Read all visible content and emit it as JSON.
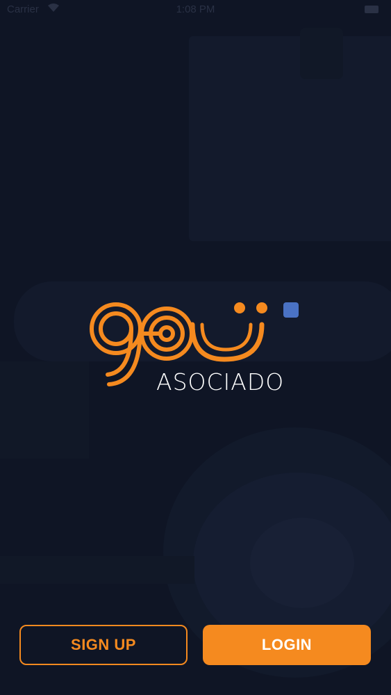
{
  "status_bar": {
    "carrier": "Carrier",
    "time": "1:08 PM"
  },
  "logo": {
    "subtitle": "ASOCIADO",
    "colors": {
      "orange": "#f58a1f",
      "blue": "#4a72c4"
    }
  },
  "buttons": {
    "signup_label": "SIGN UP",
    "login_label": "LOGIN"
  }
}
